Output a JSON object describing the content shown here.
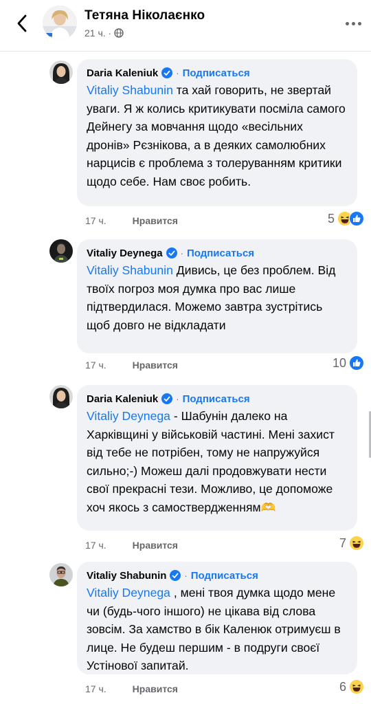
{
  "header": {
    "title": "Тетяна Ніколаєнко",
    "time": "21 ч.",
    "audience_icon": "globe-icon"
  },
  "comments": [
    {
      "author": "Daria Kaleniuk",
      "subscribe": "Подписаться",
      "mention": "Vitaliy Shabunin",
      "text": " та хай говорить, не звертай уваги. Я ж колись критикувати посміла самого Дейнегу за мовчання щодо «весільних дронів» Рєзнікова, а в деяких самолюбних нарцисів є проблема з толеруванням критики щодо себе. Нам своє робить.",
      "time": "17 ч.",
      "like": "Нравится",
      "reaction_count": "5",
      "reactions": [
        "haha",
        "like"
      ]
    },
    {
      "author": "Vitaliy Deynega",
      "subscribe": "Подписаться",
      "mention": "Vitaliy Shabunin",
      "text": " Дивись, це без проблем. Від твоїх погроз моя думка про вас лише підтвердилася. Можемо завтра зустрітись щоб довго не відкладати",
      "time": "17 ч.",
      "like": "Нравится",
      "reaction_count": "10",
      "reactions": [
        "like"
      ]
    },
    {
      "author": "Daria Kaleniuk",
      "subscribe": "Подписаться",
      "mention": "Vitaliy Deynega",
      "text": " - Шабунін далеко на Харківщині у військовій частині. Мені захист від тебе не потрібен, тому не напружуйся сильно;-) Можеш далі продовжувати нести свої прекрасні тези. Можливо, це допоможе хоч якось з самоствердженням🫶",
      "time": "17 ч.",
      "like": "Нравится",
      "reaction_count": "7",
      "reactions": [
        "haha"
      ]
    },
    {
      "author": "Vitaliy Shabunin",
      "subscribe": "Подписаться",
      "mention": "Vitaliy Deynega",
      "text": " , мені твоя думка щодо мене чи (будь-чого іншого) не цікава від слова зовсім. За хамство в бік Каленюк отримуєш в лице. Не будеш першим - в подруги своєї Устінової запитай.",
      "time": "17 ч.",
      "like": "Нравится",
      "reaction_count": "6",
      "reactions": [
        "haha"
      ]
    }
  ],
  "colors": {
    "accent": "#1877f2",
    "bubble": "#f0f2f5",
    "secondary_text": "#65676b"
  }
}
